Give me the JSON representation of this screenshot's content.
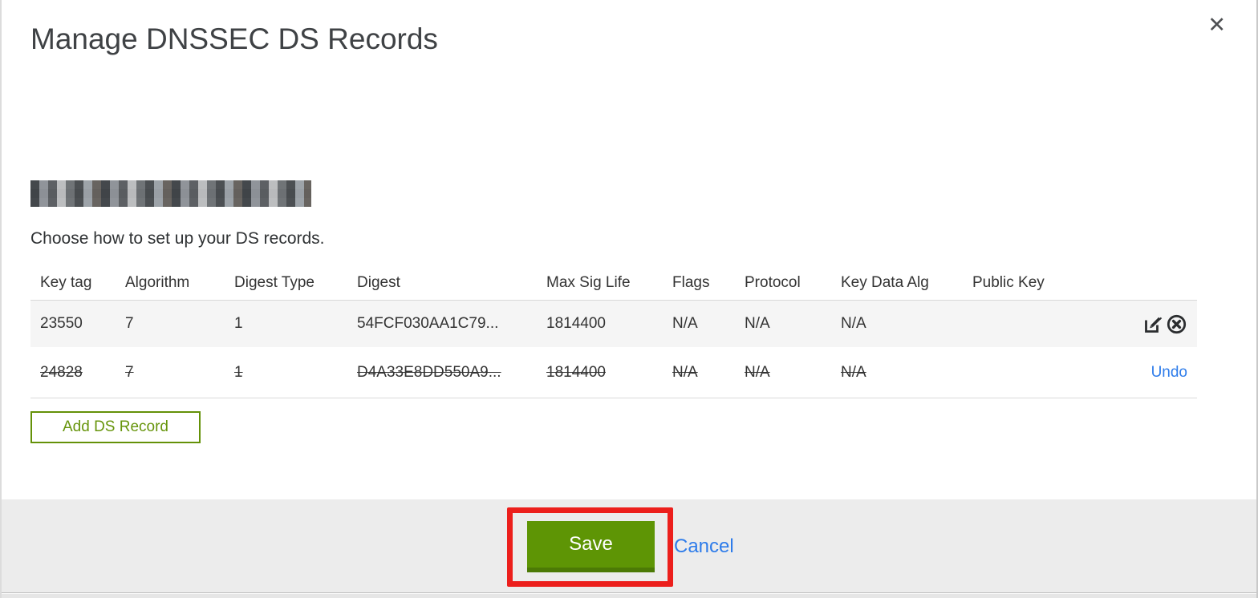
{
  "modal": {
    "title": "Manage DNSSEC DS Records",
    "close_glyph": "✕",
    "instruction": "Choose how to set up your DS records.",
    "add_button_label": "Add DS Record",
    "save_label": "Save",
    "cancel_label": "Cancel"
  },
  "table": {
    "headers": [
      "Key tag",
      "Algorithm",
      "Digest Type",
      "Digest",
      "Max Sig Life",
      "Flags",
      "Protocol",
      "Key Data Alg",
      "Public Key"
    ],
    "rows": [
      {
        "cells": [
          "23550",
          "7",
          "1",
          "54FCF030AA1C79...",
          "1814400",
          "N/A",
          "N/A",
          "N/A",
          ""
        ],
        "state": "active",
        "actions": [
          "edit",
          "delete"
        ]
      },
      {
        "cells": [
          "24828",
          "7",
          "1",
          "D4A33E8DD550A9...",
          "1814400",
          "N/A",
          "N/A",
          "N/A",
          ""
        ],
        "state": "deleted",
        "action_label": "Undo"
      }
    ]
  },
  "icons": {
    "edit": "edit-pencil-square",
    "delete": "circle-x",
    "close": "x-mark"
  },
  "colors": {
    "accent_green": "#5e9505",
    "green_border_dark": "#4c7a06",
    "outline_button_green": "#649108",
    "link_blue": "#2e7cea",
    "annotation_red": "#ec1f1c",
    "row_highlight": "#f5f5f5",
    "footer_bg": "#ececec",
    "text": "#333333"
  }
}
